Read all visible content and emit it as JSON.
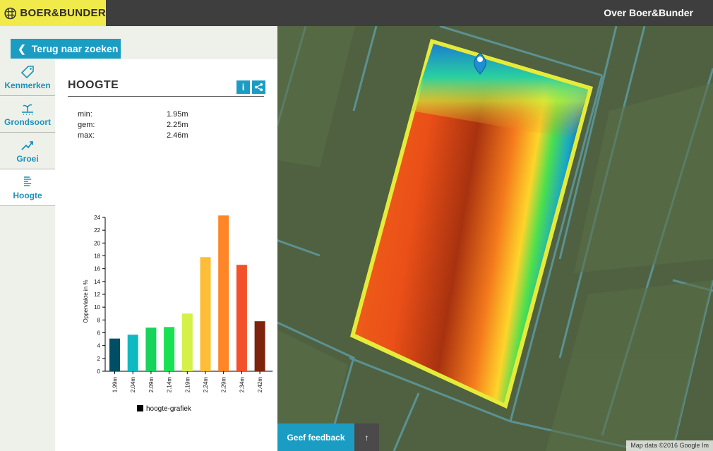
{
  "header": {
    "logo_text": "BOER&BUNDER",
    "about_link": "Over Boer&Bunder"
  },
  "back_button": "Terug naar zoeken",
  "nav": [
    {
      "label": "Kenmerken",
      "icon": "tag-icon"
    },
    {
      "label": "Grondsoort",
      "icon": "sprout-icon"
    },
    {
      "label": "Groei",
      "icon": "trend-icon"
    },
    {
      "label": "Hoogte",
      "icon": "layers-icon",
      "active": true
    }
  ],
  "section": {
    "title": "HOOGTE",
    "info_icon": "i"
  },
  "stats": [
    {
      "label": "min:",
      "value": "1.95m"
    },
    {
      "label": "gem:",
      "value": "2.25m"
    },
    {
      "label": "max:",
      "value": "2.46m"
    }
  ],
  "chart_data": {
    "type": "bar",
    "categories": [
      "1.99m",
      "2.04m",
      "2.09m",
      "2.14m",
      "2.19m",
      "2.24m",
      "2.29m",
      "2.34m",
      "2.42m"
    ],
    "values": [
      5.1,
      5.7,
      6.8,
      6.9,
      9.0,
      17.8,
      24.3,
      16.6,
      7.8
    ],
    "colors": [
      "#004e63",
      "#0fb9c1",
      "#16d35c",
      "#19e153",
      "#d5f046",
      "#fdbd36",
      "#ff8527",
      "#f2512a",
      "#7e230d"
    ],
    "ylabel": "Oppervlakte in %",
    "yticks": [
      0,
      2,
      4,
      6,
      8,
      10,
      12,
      14,
      16,
      18,
      20,
      22,
      24
    ],
    "ylim": [
      0,
      24
    ],
    "legend": "hoogte-grafiek"
  },
  "map": {
    "feedback_button": "Geef feedback",
    "up_arrow": "↑",
    "attribution": "Map data ©2016 Google Im"
  }
}
